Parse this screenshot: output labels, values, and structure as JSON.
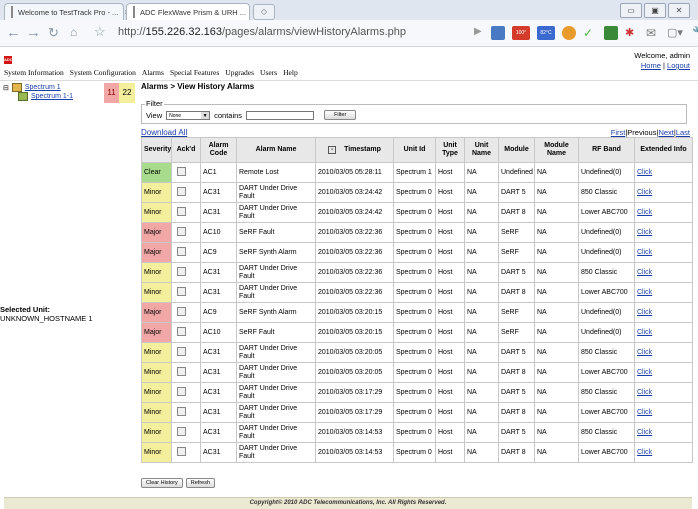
{
  "browser": {
    "tabs": [
      {
        "title": "Welcome to TestTrack Pro - ..."
      },
      {
        "title": "ADC FlexWave Prism & URH ..."
      }
    ],
    "url_prefix": "http://",
    "url_host": "155.226.32.163",
    "url_path": "/pages/alarms/viewHistoryAlarms.php",
    "ext_badges": [
      "100°",
      "82°C"
    ]
  },
  "header": {
    "welcome": "Welcome, admin",
    "home": "Home",
    "sep": "|",
    "logout": "Logout",
    "menu": [
      "System Information",
      "System Configuration",
      "Alarms",
      "Special Features",
      "Upgrades",
      "Users",
      "Help"
    ]
  },
  "tree": {
    "root": "Spectrum 1",
    "child": "Spectrum 1-1",
    "major_count": "11",
    "minor_count": "22"
  },
  "selected_unit": {
    "label": "Selected Unit:",
    "value": "UNKNOWN_HOSTNAME 1"
  },
  "page": {
    "title": "Alarms > View History Alarms",
    "filter_legend": "Filter",
    "view_label": "View",
    "view_value": "None",
    "contains_label": "contains",
    "filter_button": "Filter",
    "download_all": "Download All",
    "pager": {
      "first": "First",
      "previous": "Previous",
      "next": "Next",
      "last": "Last"
    }
  },
  "table": {
    "columns": [
      "Severity",
      "Ack'd",
      "Alarm Code",
      "Alarm Name",
      "Timestamp",
      "Unit Id",
      "Unit Type",
      "Unit Name",
      "Module",
      "Module Name",
      "RF Band",
      "Extended Info"
    ],
    "rows": [
      {
        "severity": "Clear",
        "code": "AC1",
        "name": "Remote Lost",
        "ts": "2010/03/05 05:28:11",
        "unit_id": "Spectrum 1",
        "unit_type": "Host",
        "unit_name": "NA",
        "module": "Undefined",
        "module_name": "NA",
        "rf_band": "Undefined(0)",
        "info": "Click"
      },
      {
        "severity": "Minor",
        "code": "AC31",
        "name": "DART Under Drive Fault",
        "ts": "2010/03/05 03:24:42",
        "unit_id": "Spectrum 0",
        "unit_type": "Host",
        "unit_name": "NA",
        "module": "DART 5",
        "module_name": "NA",
        "rf_band": "850 Classic",
        "info": "Click"
      },
      {
        "severity": "Minor",
        "code": "AC31",
        "name": "DART Under Drive Fault",
        "ts": "2010/03/05 03:24:42",
        "unit_id": "Spectrum 0",
        "unit_type": "Host",
        "unit_name": "NA",
        "module": "DART 8",
        "module_name": "NA",
        "rf_band": "Lower ABC700",
        "info": "Click"
      },
      {
        "severity": "Major",
        "code": "AC10",
        "name": "SeRF Fault",
        "ts": "2010/03/05 03:22:36",
        "unit_id": "Spectrum 0",
        "unit_type": "Host",
        "unit_name": "NA",
        "module": "SeRF",
        "module_name": "NA",
        "rf_band": "Undefined(0)",
        "info": "Click"
      },
      {
        "severity": "Major",
        "code": "AC9",
        "name": "SeRF Synth Alarm",
        "ts": "2010/03/05 03:22:36",
        "unit_id": "Spectrum 0",
        "unit_type": "Host",
        "unit_name": "NA",
        "module": "SeRF",
        "module_name": "NA",
        "rf_band": "Undefined(0)",
        "info": "Click"
      },
      {
        "severity": "Minor",
        "code": "AC31",
        "name": "DART Under Drive Fault",
        "ts": "2010/03/05 03:22:36",
        "unit_id": "Spectrum 0",
        "unit_type": "Host",
        "unit_name": "NA",
        "module": "DART 5",
        "module_name": "NA",
        "rf_band": "850 Classic",
        "info": "Click"
      },
      {
        "severity": "Minor",
        "code": "AC31",
        "name": "DART Under Drive Fault",
        "ts": "2010/03/05 03:22:36",
        "unit_id": "Spectrum 0",
        "unit_type": "Host",
        "unit_name": "NA",
        "module": "DART 8",
        "module_name": "NA",
        "rf_band": "Lower ABC700",
        "info": "Click"
      },
      {
        "severity": "Major",
        "code": "AC9",
        "name": "SeRF Synth Alarm",
        "ts": "2010/03/05 03:20:15",
        "unit_id": "Spectrum 0",
        "unit_type": "Host",
        "unit_name": "NA",
        "module": "SeRF",
        "module_name": "NA",
        "rf_band": "Undefined(0)",
        "info": "Click"
      },
      {
        "severity": "Major",
        "code": "AC10",
        "name": "SeRF Fault",
        "ts": "2010/03/05 03:20:15",
        "unit_id": "Spectrum 0",
        "unit_type": "Host",
        "unit_name": "NA",
        "module": "SeRF",
        "module_name": "NA",
        "rf_band": "Undefined(0)",
        "info": "Click"
      },
      {
        "severity": "Minor",
        "code": "AC31",
        "name": "DART Under Drive Fault",
        "ts": "2010/03/05 03:20:05",
        "unit_id": "Spectrum 0",
        "unit_type": "Host",
        "unit_name": "NA",
        "module": "DART 5",
        "module_name": "NA",
        "rf_band": "850 Classic",
        "info": "Click"
      },
      {
        "severity": "Minor",
        "code": "AC31",
        "name": "DART Under Drive Fault",
        "ts": "2010/03/05 03:20:05",
        "unit_id": "Spectrum 0",
        "unit_type": "Host",
        "unit_name": "NA",
        "module": "DART 8",
        "module_name": "NA",
        "rf_band": "Lower ABC700",
        "info": "Click"
      },
      {
        "severity": "Minor",
        "code": "AC31",
        "name": "DART Under Drive Fault",
        "ts": "2010/03/05 03:17:29",
        "unit_id": "Spectrum 0",
        "unit_type": "Host",
        "unit_name": "NA",
        "module": "DART 5",
        "module_name": "NA",
        "rf_band": "850 Classic",
        "info": "Click"
      },
      {
        "severity": "Minor",
        "code": "AC31",
        "name": "DART Under Drive Fault",
        "ts": "2010/03/05 03:17:29",
        "unit_id": "Spectrum 0",
        "unit_type": "Host",
        "unit_name": "NA",
        "module": "DART 8",
        "module_name": "NA",
        "rf_band": "Lower ABC700",
        "info": "Click"
      },
      {
        "severity": "Minor",
        "code": "AC31",
        "name": "DART Under Drive Fault",
        "ts": "2010/03/05 03:14:53",
        "unit_id": "Spectrum 0",
        "unit_type": "Host",
        "unit_name": "NA",
        "module": "DART 5",
        "module_name": "NA",
        "rf_band": "850 Classic",
        "info": "Click"
      },
      {
        "severity": "Minor",
        "code": "AC31",
        "name": "DART Under Drive Fault",
        "ts": "2010/03/05 03:14:53",
        "unit_id": "Spectrum 0",
        "unit_type": "Host",
        "unit_name": "NA",
        "module": "DART 8",
        "module_name": "NA",
        "rf_band": "Lower ABC700",
        "info": "Click"
      }
    ]
  },
  "buttons": {
    "clear_history": "Clear History",
    "refresh": "Refresh"
  },
  "footer": "Copyright© 2010 ADC Telecommunications, Inc. All Rights Reserved.",
  "colors": {
    "clear": "#a8dc8c",
    "minor": "#f4ef9c",
    "major": "#f2a7a7",
    "link": "#1a3ea8"
  }
}
